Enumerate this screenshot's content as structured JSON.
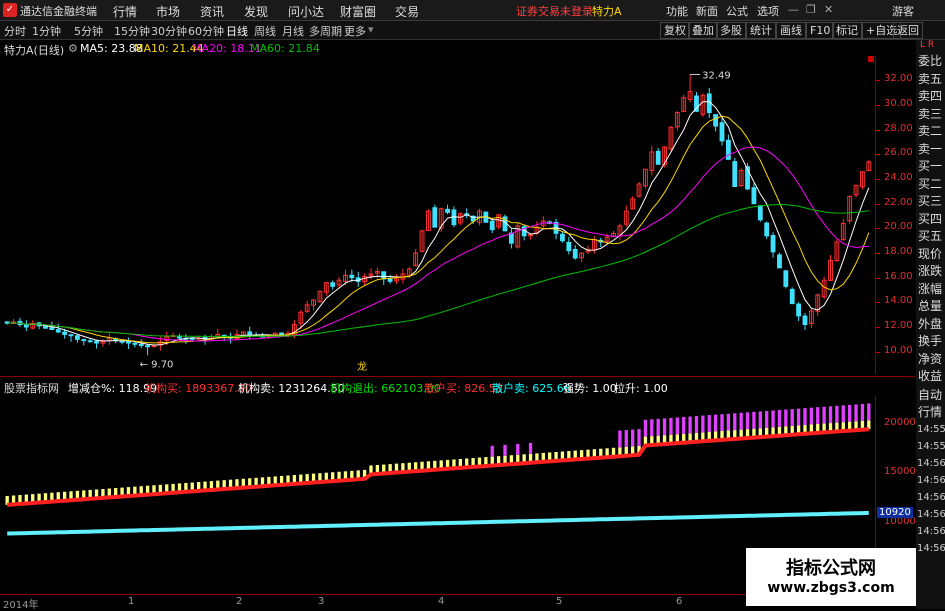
{
  "topbar": {
    "app_name": "通达信金融终端",
    "menus": [
      "行情",
      "市场",
      "资讯",
      "发现",
      "问小达",
      "财富圈",
      "交易"
    ],
    "login_status": "证券交易未登录",
    "stock_title": "特力A",
    "right_menus": [
      "功能",
      "新面",
      "公式",
      "选项"
    ],
    "guest": "游客"
  },
  "toolbar": {
    "periods": [
      "分时",
      "1分钟",
      "5分钟",
      "15分钟",
      "30分钟",
      "60分钟",
      "日线",
      "周线",
      "月线",
      "多周期",
      "更多"
    ],
    "active_period": "日线",
    "right_buttons": [
      "复权",
      "叠加",
      "多股",
      "统计",
      "画线",
      "F10",
      "标记",
      "+自选",
      "返回"
    ]
  },
  "info": {
    "stock": "特力A(日线)",
    "ma5": "MA5: 23.88",
    "ma10": "MA10: 21.44",
    "ma20": "MA20: 18.11",
    "ma60": "MA60: 21.84",
    "colors": {
      "ma5": "#ffffff",
      "ma10": "#ffd700",
      "ma20": "#ff00ff",
      "ma60": "#00c000"
    }
  },
  "axis": {
    "prices": [
      "32.00",
      "30.00",
      "28.00",
      "26.00",
      "24.00",
      "22.00",
      "20.00",
      "18.00",
      "16.00",
      "14.00",
      "12.00",
      "10.00"
    ],
    "high_label": "32.49",
    "low_label": "9.70",
    "marker": "龙"
  },
  "side_panel": {
    "top_labels": [
      "L",
      "R"
    ],
    "items": [
      "委比",
      "卖五",
      "卖四",
      "卖三",
      "卖二",
      "卖一",
      "买一",
      "买二",
      "买三",
      "买四",
      "买五",
      "现价",
      "涨跌",
      "涨幅",
      "总量",
      "外盘",
      "换手",
      "净资",
      "收益",
      "自动",
      "行情"
    ],
    "times": [
      "14:55",
      "14:55",
      "14:56",
      "14:56",
      "14:56",
      "14:56",
      "14:56",
      "14:56"
    ]
  },
  "indicator": {
    "name": "股票指标网",
    "add_pos": "增减仓%: 118.99",
    "inst_buy": "机构买: 1893367.50",
    "inst_sell": "机构卖: 1231264.50",
    "inst_out": "机构退出: 662103.00",
    "retail_buy": "散户买: 826.58",
    "retail_sell": "散户卖: 625.66",
    "strength": "强势: 1.00",
    "lift": "拉升: 1.00",
    "axis_labels": [
      "20000",
      "15000",
      "10000"
    ],
    "current": "10920"
  },
  "bottom_axis": {
    "labels": [
      "2014年",
      "1",
      "2",
      "3",
      "4",
      "5",
      "6",
      "7"
    ]
  },
  "watermark": {
    "line1": "指标公式网",
    "line2": "www.zbgs3.com"
  },
  "chart_data": {
    "type": "candlestick",
    "ylim": [
      9,
      33.5
    ],
    "closes": [
      12.3,
      12.4,
      12.2,
      12.0,
      12.3,
      12.1,
      11.9,
      11.8,
      11.6,
      11.4,
      11.3,
      11.0,
      10.9,
      10.8,
      10.7,
      10.9,
      11.1,
      10.9,
      10.8,
      10.7,
      10.6,
      10.5,
      10.4,
      10.5,
      10.8,
      11.2,
      11.3,
      11.1,
      11.0,
      11.0,
      11.1,
      11.0,
      11.2,
      11.4,
      11.2,
      11.1,
      11.4,
      11.6,
      11.4,
      11.3,
      11.2,
      11.3,
      11.5,
      11.4,
      11.5,
      12.2,
      13.2,
      13.8,
      14.2,
      14.9,
      15.6,
      15.3,
      15.8,
      16.2,
      16.0,
      15.7,
      16.1,
      16.3,
      16.5,
      15.9,
      15.7,
      15.9,
      16.3,
      16.7,
      18.0,
      19.8,
      21.4,
      20.1,
      21.6,
      21.3,
      20.3,
      21.2,
      21.1,
      20.6,
      21.4,
      20.5,
      19.9,
      21.1,
      19.8,
      18.8,
      20.2,
      19.4,
      19.5,
      20.1,
      20.6,
      20.4,
      19.6,
      19.0,
      18.2,
      17.6,
      18.0,
      18.3,
      19.1,
      18.9,
      19.3,
      19.6,
      20.2,
      21.4,
      22.4,
      23.6,
      24.8,
      26.2,
      25.2,
      26.6,
      28.2,
      29.4,
      30.6,
      31.1,
      29.5,
      30.8,
      29.4,
      28.3,
      27.1,
      25.6,
      23.4,
      24.7,
      23.2,
      22.0,
      20.7,
      19.4,
      18.1,
      16.8,
      15.3,
      13.9,
      12.9,
      12.2,
      13.3,
      14.6,
      15.8,
      17.4,
      18.9,
      20.4,
      22.6,
      23.5,
      24.6,
      25.4
    ],
    "ma5_current": 23.88,
    "ma10_current": 21.44,
    "ma20_current": 18.11,
    "ma60_current": 21.84,
    "high": 32.49,
    "low": 9.7
  }
}
